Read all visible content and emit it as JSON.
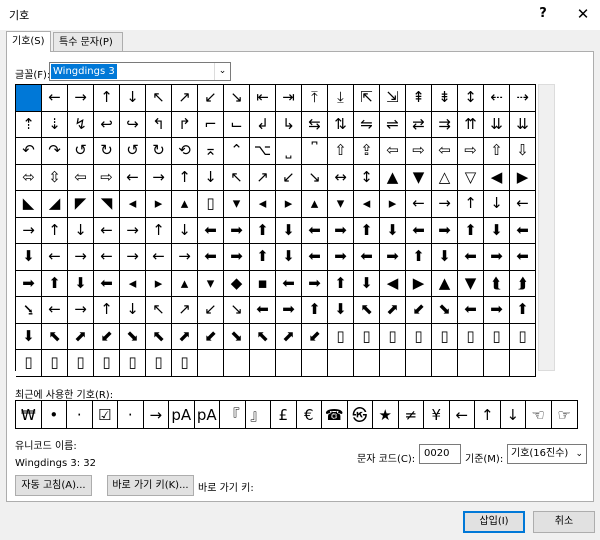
{
  "window": {
    "title": "기호",
    "help": "?",
    "close": "✕"
  },
  "tabs": [
    {
      "label": "기호(S)",
      "active": true
    },
    {
      "label": "특수 문자(P)",
      "active": false
    }
  ],
  "font": {
    "label": "글꼴(F):",
    "value": "Wingdings 3"
  },
  "symbols": [
    "",
    "←",
    "→",
    "↑",
    "↓",
    "↖",
    "↗",
    "↙",
    "↘",
    "⇤",
    "⇥",
    "⤒",
    "⤓",
    "⇱",
    "⇲",
    "⇞",
    "⇟",
    "↕",
    "⇠",
    "⇢",
    "⇡",
    "⇣",
    "↯",
    "↩",
    "↪",
    "↰",
    "↱",
    "⮤",
    "⮥",
    "⮦",
    "⮧",
    "↲",
    "↳",
    "⇆",
    "⇅",
    "⇋",
    "⇌",
    "⇄",
    "⇉",
    "⇈",
    "⇊",
    "↶",
    "↷",
    "↺",
    "↻",
    "↺",
    "↻",
    "⟲",
    "⌅",
    "⌃",
    "⌥",
    "⎵",
    "⎴",
    "⇧",
    "⇪",
    "⇦",
    "⇨",
    "⇦",
    "⇨",
    "⇧",
    "⇩",
    "⬄",
    "⇳",
    "⇦",
    "⇨",
    "←",
    "→",
    "↑",
    "↓",
    "↖",
    "↗",
    "↙",
    "↘",
    "↔",
    "↕",
    "▲",
    "▼",
    "△",
    "▽",
    "◀",
    "▶",
    "◁",
    "▷",
    "◣",
    "◢",
    "◤",
    "◥",
    "◀",
    "▶",
    "▲",
    "▼",
    "◀",
    "▶",
    "▲",
    "▼",
    "◀",
    "▶",
    "⇠",
    "⇢",
    "⇡",
    "⇣",
    "⇐",
    "→",
    "↑",
    "↓",
    "←",
    "→",
    "↑",
    "↓",
    "←",
    "→",
    "↑",
    "↓",
    "←",
    "→",
    "↑",
    "↓",
    "⇐",
    "⇒",
    "⇑",
    "⇓",
    "←",
    "→",
    "↑",
    "↓",
    "⬅",
    "➡",
    "⬆",
    "⬇",
    "⬅",
    "➡",
    "⬆",
    "⬇",
    "⬅",
    "➡",
    "⬆",
    "⬇",
    "⬅",
    "➡",
    "⬆",
    "⬇",
    "⬌",
    "⬍",
    "⇐",
    "⇒",
    "⬅",
    "➡",
    "⬆",
    "⬇",
    "⬉",
    "⬈",
    "⬋",
    "⬊",
    "⬅",
    "➡",
    "⬆",
    "⬇",
    "⬉",
    "⬈",
    "⬋",
    "⬊",
    "⮌",
    "⮍",
    "⮎",
    "⮏",
    "⮐",
    "⮑",
    "⮒",
    "⮓",
    "⮔",
    "⮕",
    "⮖",
    "⮗",
    "⮘",
    "⮙",
    "⮚",
    "⮛",
    "⮜",
    "⮝",
    "⮞",
    "⮟",
    "⬀",
    "⬁",
    "⬂",
    "⬃",
    "⬄",
    "⬅",
    "⬆",
    "⬇",
    "⬈",
    "⬉",
    "⬊",
    "⬋",
    "⬌",
    "⬍",
    "⬎",
    "⬏",
    "⬐",
    "⬑",
    "⬒",
    "⬓",
    "⬔",
    "⬕",
    "⬖",
    "⬗",
    "⬘",
    "⬙",
    "⬚",
    "⬛",
    "⬜",
    "⬝",
    "⬞",
    "⬟",
    "⬠",
    "⬡",
    "⬢",
    "⬣",
    "⬤",
    "⬥",
    "⬦",
    "⬧",
    "⬨",
    "⬩",
    "⬪",
    "⬫",
    "⬬",
    "⬭",
    "⬮",
    "⬯",
    "⬰",
    "⬱",
    "⬲",
    "⬳",
    "⬴",
    "⬵",
    "⬶",
    "⬷",
    "⬸",
    "⬹",
    "⬺",
    "⬻"
  ],
  "grid_cells": [
    "",
    "←",
    "→",
    "↑",
    "↓",
    "↖",
    "↗",
    "↙",
    "↘",
    "⇤",
    "⇥",
    "⤒",
    "⤓",
    "⇱",
    "⇲",
    "⇞",
    "⇟",
    "↕",
    "⇠",
    "⇢",
    "⇡",
    "⇣",
    "↯",
    "↩",
    "↪",
    "↰",
    "↱",
    "⌐",
    "⌙",
    "↲",
    "↳",
    "⇆",
    "⇅",
    "⇋",
    "⇌",
    "⇄",
    "⇉",
    "⇈",
    "⇊",
    "⇊",
    "↶",
    "↷",
    "↺",
    "↻",
    "↺",
    "↻",
    "⟲",
    "⌅",
    "⌃",
    "⌥",
    "⎵",
    "⎴",
    "⇧",
    "⇪",
    "⇦",
    "⇨",
    "⇦",
    "⇨",
    "⇧",
    "⇩",
    "⬄",
    "⇳",
    "⇦",
    "⇨",
    "←",
    "→",
    "↑",
    "↓",
    "↖",
    "↗",
    "↙",
    "↘",
    "↔",
    "↕",
    "▲",
    "▼",
    "△",
    "▽",
    "◀",
    "▶",
    "◣",
    "◢",
    "◤",
    "◥",
    "◂",
    "▸",
    "▴",
    "▯",
    "▾",
    "◂",
    "▸",
    "▴",
    "▾",
    "◂",
    "▸",
    "←",
    "→",
    "↑",
    "↓",
    "←",
    "→",
    "↑",
    "↓",
    "←",
    "→",
    "↑",
    "↓",
    "⬅",
    "➡",
    "⬆",
    "⬇",
    "⬅",
    "➡",
    "⬆",
    "⬇",
    "⬅",
    "➡",
    "⬆",
    "⬇",
    "⬅",
    "⬇",
    "←",
    "→",
    "←",
    "→",
    "←",
    "→",
    "⬅",
    "➡",
    "⬆",
    "⬇",
    "⬅",
    "➡",
    "⬅",
    "➡",
    "⬆",
    "⬇",
    "⬅",
    "➡",
    "⬅",
    "➡",
    "⬆",
    "⬇",
    "⬅",
    "◂",
    "▸",
    "▴",
    "▾",
    "◆",
    "▪",
    "⬅",
    "➡",
    "⬆",
    "⬇",
    "◀",
    "▶",
    "▲",
    "▼",
    "⮬",
    "⮭",
    "⭸",
    "←",
    "→",
    "↑",
    "↓",
    "↖",
    "↗",
    "↙",
    "↘",
    "⬅",
    "➡",
    "⬆",
    "⬇",
    "⬉",
    "⬈",
    "⬋",
    "⬊",
    "⬅",
    "➡",
    "⬆",
    "⬇",
    "⬉",
    "⬈",
    "⬋",
    "⬊",
    "⬉",
    "⬈",
    "⬋",
    "⬊",
    "⬉",
    "⬈",
    "⬋",
    "▯",
    "▯",
    "▯",
    "▯",
    "▯",
    "▯",
    "▯",
    "▯",
    "▯",
    "▯",
    "▯",
    "▯",
    "▯",
    "▯",
    "▯",
    "",
    "",
    "",
    "",
    "",
    "",
    "",
    "",
    "",
    "",
    "",
    "",
    ""
  ],
  "recent": {
    "label": "최근에 사용한 기호(R):",
    "items": [
      "₩",
      "•",
      "·",
      "☑",
      "·",
      "→",
      "pA",
      "pA",
      "『",
      "』",
      "£",
      "€",
      "☎",
      "㉿",
      "★",
      "≠",
      "¥",
      "←",
      "↑",
      "↓",
      "☜",
      "☞"
    ]
  },
  "unicode_name": {
    "label": "유니코드 이름:",
    "value": "Wingdings 3: 32"
  },
  "char_code": {
    "label": "문자 코드(C):",
    "value": "0020"
  },
  "base": {
    "label": "기준(M):",
    "value": "기호(16진수)"
  },
  "buttons": {
    "autocorrect": "자동 고침(A)...",
    "shortcut": "바로 가기 키(K)...",
    "shortcut_label": "바로 가기 키:",
    "insert": "삽입(I)",
    "cancel": "취소"
  }
}
